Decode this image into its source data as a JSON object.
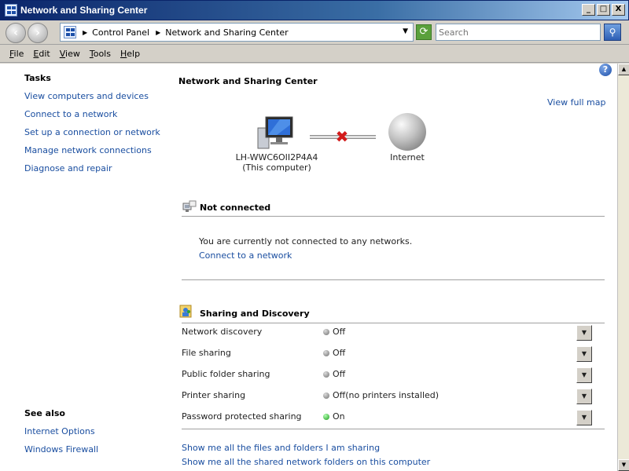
{
  "window": {
    "title": "Network and Sharing Center",
    "buttons": [
      "_",
      "□",
      "X"
    ]
  },
  "address": {
    "crumbs": [
      "Control Panel",
      "Network and Sharing Center"
    ],
    "search_placeholder": "Search"
  },
  "menu": {
    "items": [
      "File",
      "Edit",
      "View",
      "Tools",
      "Help"
    ]
  },
  "sidebar": {
    "tasks_heading": "Tasks",
    "tasks": [
      "View computers and devices",
      "Connect to a network",
      "Set up a connection or network",
      "Manage network connections",
      "Diagnose and repair"
    ],
    "see_also_heading": "See also",
    "see_also": [
      "Internet Options",
      "Windows Firewall"
    ]
  },
  "main": {
    "title": "Network and Sharing Center",
    "view_full_map": "View full map",
    "map": {
      "computer_name": "LH-WWC6OII2P4A4",
      "computer_subtitle": "(This computer)",
      "internet_label": "Internet"
    },
    "connection": {
      "heading": "Not connected",
      "message": "You are currently not connected to any networks.",
      "connect_link": "Connect to a network"
    },
    "sharing": {
      "heading": "Sharing and Discovery",
      "rows": [
        {
          "label": "Network discovery",
          "value": "Off",
          "state": "off"
        },
        {
          "label": "File sharing",
          "value": "Off",
          "state": "off"
        },
        {
          "label": "Public folder sharing",
          "value": "Off",
          "state": "off"
        },
        {
          "label": "Printer sharing",
          "value": "Off(no printers installed)",
          "state": "off"
        },
        {
          "label": "Password protected sharing",
          "value": "On",
          "state": "on"
        }
      ]
    },
    "bottom_links": [
      "Show me all the files and folders I am sharing",
      "Show me all the shared network folders on this computer"
    ]
  },
  "colors": {
    "link": "#1a4ea0",
    "status_off": "#808080",
    "status_on": "#1a9a1a",
    "error_x": "#d21a1a"
  },
  "icons": {
    "help": "help-icon",
    "computer": "computer-icon",
    "internet": "globe-icon",
    "not_connected": "network-disconnected-icon",
    "sharing": "sharing-icon"
  }
}
